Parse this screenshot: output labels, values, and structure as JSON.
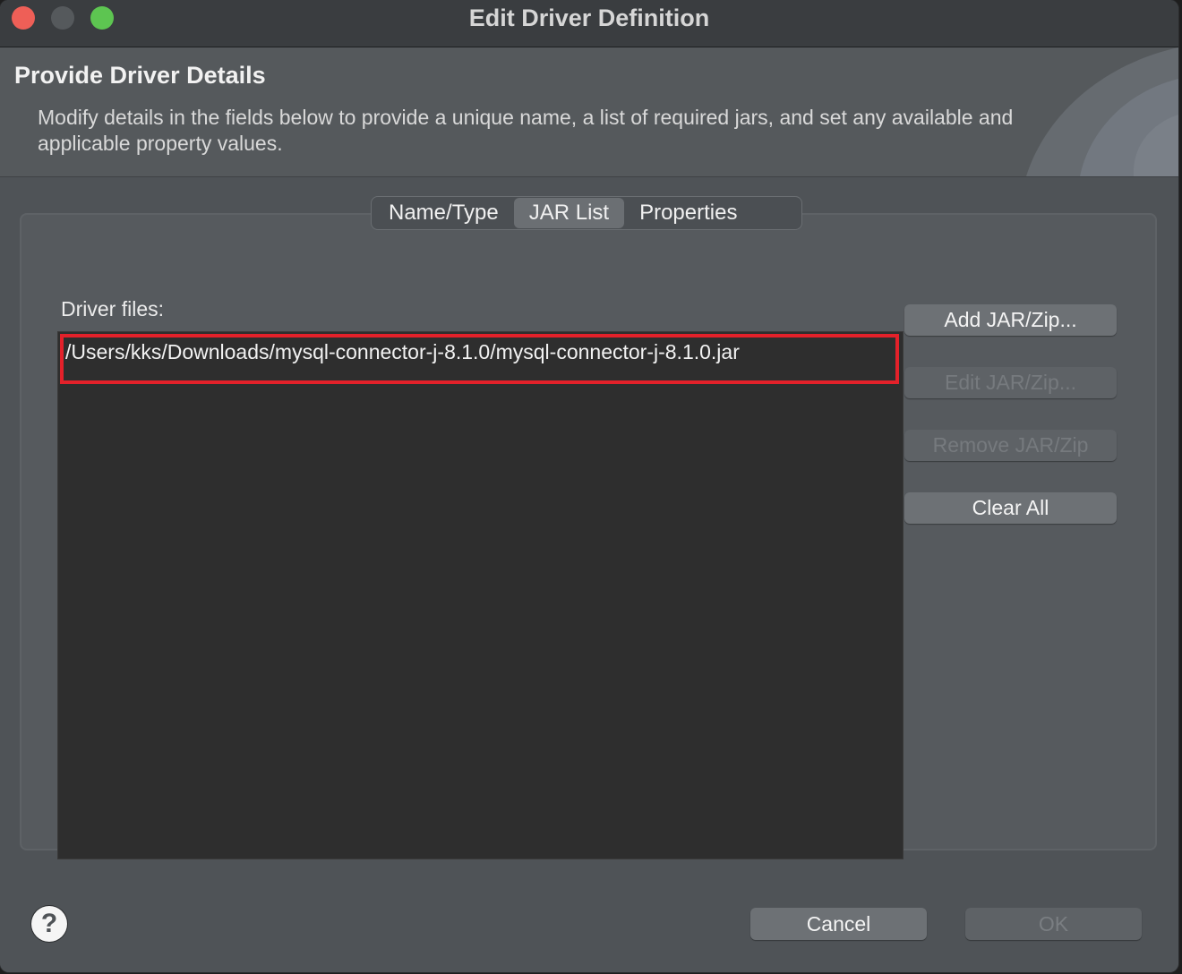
{
  "window": {
    "title": "Edit Driver Definition"
  },
  "banner": {
    "title": "Provide Driver Details",
    "description": "Modify details in the fields below to provide a unique name, a list of required jars, and set any available and applicable property values."
  },
  "tabs": [
    {
      "label": "Name/Type",
      "active": false
    },
    {
      "label": "JAR List",
      "active": true
    },
    {
      "label": "Properties",
      "active": false
    }
  ],
  "jar_list": {
    "label": "Driver files:",
    "items": [
      "/Users/kks/Downloads/mysql-connector-j-8.1.0/mysql-connector-j-8.1.0.jar"
    ]
  },
  "side_buttons": {
    "add": "Add JAR/Zip...",
    "edit": "Edit JAR/Zip...",
    "remove": "Remove JAR/Zip",
    "clear": "Clear All"
  },
  "footer": {
    "help_icon": "question-mark-icon",
    "cancel": "Cancel",
    "ok": "OK"
  },
  "colors": {
    "highlight_border": "#e3212a",
    "close": "#ee5f57",
    "maximize": "#5dc551"
  }
}
